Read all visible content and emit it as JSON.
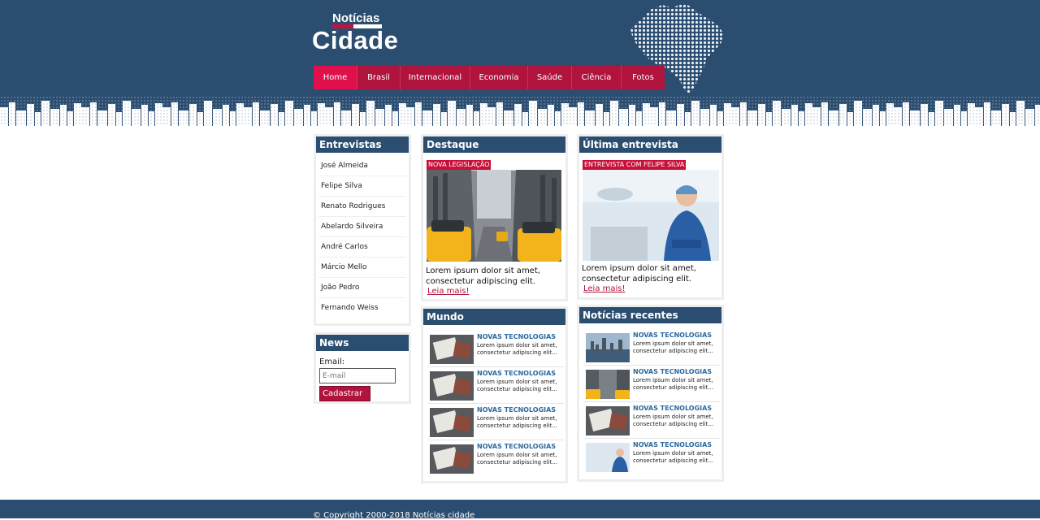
{
  "logo": {
    "small": "Notícias",
    "big": "Cidade"
  },
  "nav": [
    "Home",
    "Brasil",
    "Internacional",
    "Economia",
    "Saúde",
    "Ciência",
    "Fotos"
  ],
  "entrevistas": {
    "title": "Entrevistas",
    "items": [
      "José Almeida",
      "Felipe Silva",
      "Renato Rodrigues",
      "Abelardo Silveira",
      "André Carlos",
      "Márcio Mello",
      "João Pedro",
      "Fernando Weiss"
    ]
  },
  "news": {
    "title": "News",
    "label": "Email:",
    "placeholder": "E-mail",
    "button": "Cadastrar"
  },
  "destaque": {
    "title": "Destaque",
    "tag": "NOVA LEGISLAÇÃO",
    "text": "Lorem ipsum dolor sit amet, consectetur adipiscing elit.",
    "link": "Leia mais!"
  },
  "ultima": {
    "title": "Última entrevista",
    "tag": "ENTREVISTA COM FELIPE SILVA",
    "text": "Lorem ipsum dolor sit amet, consectetur adipiscing elit.",
    "link": "Leia mais!"
  },
  "mundo": {
    "title": "Mundo",
    "items": [
      {
        "title": "NOVAS TECNOLOGIAS",
        "text": "Lorem ipsum dolor sit amet, consectetur adipiscing elit...",
        "thumb": "desk"
      },
      {
        "title": "NOVAS TECNOLOGIAS",
        "text": "Lorem ipsum dolor sit amet, consectetur adipiscing elit...",
        "thumb": "desk"
      },
      {
        "title": "NOVAS TECNOLOGIAS",
        "text": "Lorem ipsum dolor sit amet, consectetur adipiscing elit...",
        "thumb": "desk"
      },
      {
        "title": "NOVAS TECNOLOGIAS",
        "text": "Lorem ipsum dolor sit amet, consectetur adipiscing elit...",
        "thumb": "desk"
      }
    ]
  },
  "recentes": {
    "title": "Notícias recentes",
    "items": [
      {
        "title": "NOVAS TECNOLOGIAS",
        "text": "Lorem ipsum dolor sit amet, consectetur adipiscing elit...",
        "thumb": "city"
      },
      {
        "title": "NOVAS TECNOLOGIAS",
        "text": "Lorem ipsum dolor sit amet, consectetur adipiscing elit...",
        "thumb": "taxi"
      },
      {
        "title": "NOVAS TECNOLOGIAS",
        "text": "Lorem ipsum dolor sit amet, consectetur adipiscing elit...",
        "thumb": "desk"
      },
      {
        "title": "NOVAS TECNOLOGIAS",
        "text": "Lorem ipsum dolor sit amet, consectetur adipiscing elit...",
        "thumb": "doctor"
      }
    ]
  },
  "footer": {
    "copyright": "© Copyright 2000-2018 Notícias cidade"
  },
  "colors": {
    "primary": "#2b4d70",
    "accent": "#b0133c",
    "accent_active": "#e0114a"
  }
}
